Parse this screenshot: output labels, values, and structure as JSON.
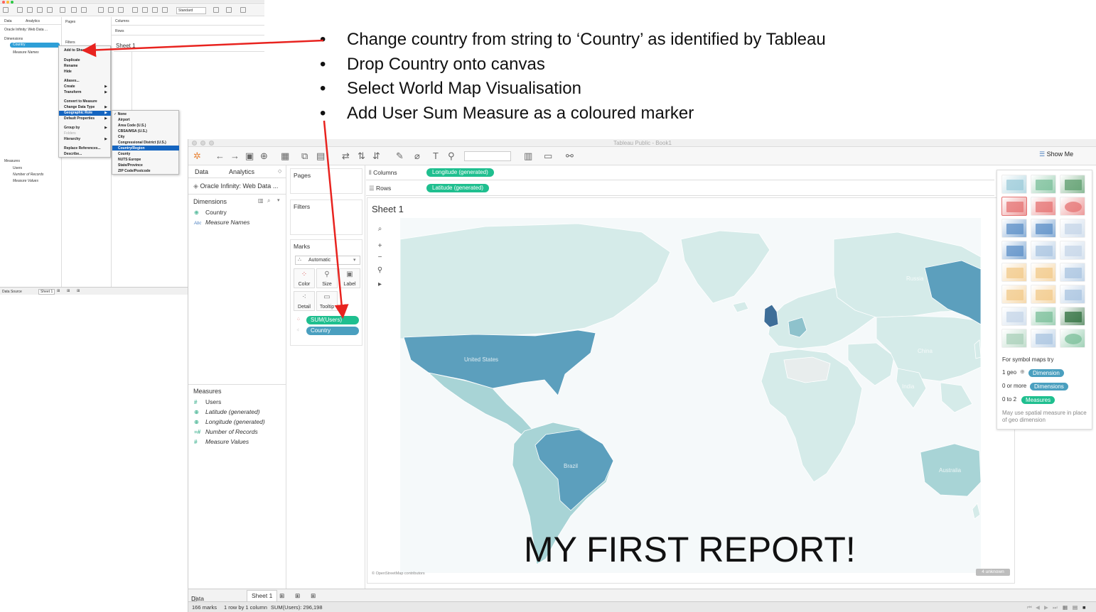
{
  "bullets": [
    "Change country from string to ‘Country’ as identified by Tableau",
    "Drop Country onto canvas",
    "Select World Map Visualisation",
    "Add User Sum Measure as a coloured marker"
  ],
  "small_screenshot": {
    "toolbar_std": "Standard",
    "data_tab": "Data",
    "analytics_tab": "Analytics",
    "datasource": "Oracle Infinity: Web Data ...",
    "dimensions": "Dimensions",
    "country_pill": "Country",
    "measure_names": "Measure Names",
    "pages": "Pages",
    "filters": "Filters",
    "columns": "Columns",
    "rows": "Rows",
    "sheet": "Sheet 1",
    "measures": "Measures",
    "measure_fields": [
      "Users",
      "Number of Records",
      "Measure Values"
    ],
    "status": {
      "data_source": "Data Source",
      "sheet": "Sheet 1"
    },
    "context_menu": [
      "Add to Sheet",
      "Duplicate",
      "Rename",
      "Hide",
      "Aliases...",
      "Create",
      "Transform",
      "Convert to Measure",
      "Change Data Type",
      "Geographic Role",
      "Default Properties",
      "Group by",
      "Folders",
      "Hierarchy",
      "Replace References...",
      "Describe..."
    ],
    "geo_submenu": [
      "✓ None",
      "Airport",
      "Area Code (U.S.)",
      "CBSA/MSA (U.S.)",
      "City",
      "Congressional District (U.S.)",
      "Country/Region",
      "County",
      "NUTS Europe",
      "State/Province",
      "ZIP Code/Postcode"
    ]
  },
  "window": {
    "title": "Tableau Public - Book1",
    "show_me": "Show Me",
    "data_tab": "Data",
    "analytics_tab": "Analytics",
    "datasource": "Oracle Infinity: Web Data ...",
    "dimensions_header": "Dimensions",
    "dimensions": [
      "Country",
      "Measure Names"
    ],
    "measures_header": "Measures",
    "measures": [
      "Users",
      "Latitude (generated)",
      "Longitude (generated)",
      "Number of Records",
      "Measure Values"
    ],
    "pages": "Pages",
    "filters": "Filters",
    "marks": "Marks",
    "mark_type": "Automatic",
    "mark_buttons": [
      "Color",
      "Size",
      "Label",
      "Detail",
      "Tooltip"
    ],
    "mark_pills": [
      "SUM(Users)",
      "Country"
    ],
    "columns_label": "Columns",
    "columns_pill": "Longitude (generated)",
    "rows_label": "Rows",
    "rows_pill": "Latitude (generated)",
    "sheet_title": "Sheet 1",
    "map_labels": [
      "Russia",
      "United States",
      "China",
      "Brazil",
      "Australia",
      "India"
    ],
    "osm_credit": "© OpenStreetMap contributors",
    "unknown_badge": "4 unknown",
    "overlay_text": "MY FIRST REPORT!",
    "showme_hint": "For symbol maps try",
    "showme_rows": [
      {
        "count": "1 geo",
        "pill": "Dimension"
      },
      {
        "count": "0 or more",
        "pill": "Dimensions"
      },
      {
        "count": "0 to 2",
        "pill": "Measures"
      }
    ],
    "showme_note": "May use spatial measure in place of geo dimension",
    "tabs": {
      "data_source": "Data Source",
      "sheet": "Sheet 1"
    },
    "status": {
      "marks": "166 marks",
      "rows": "1 row by 1 column",
      "sum": "SUM(Users): 296,198"
    }
  },
  "colors": {
    "pill_green": "#1fbf8f",
    "pill_blue": "#4a9fbf",
    "arrow_red": "#e8231f",
    "land_light": "#d5ebe9",
    "land_mid": "#a8d4d6",
    "land_dark": "#5c9fbd",
    "land_darkest": "#3e6e98"
  }
}
